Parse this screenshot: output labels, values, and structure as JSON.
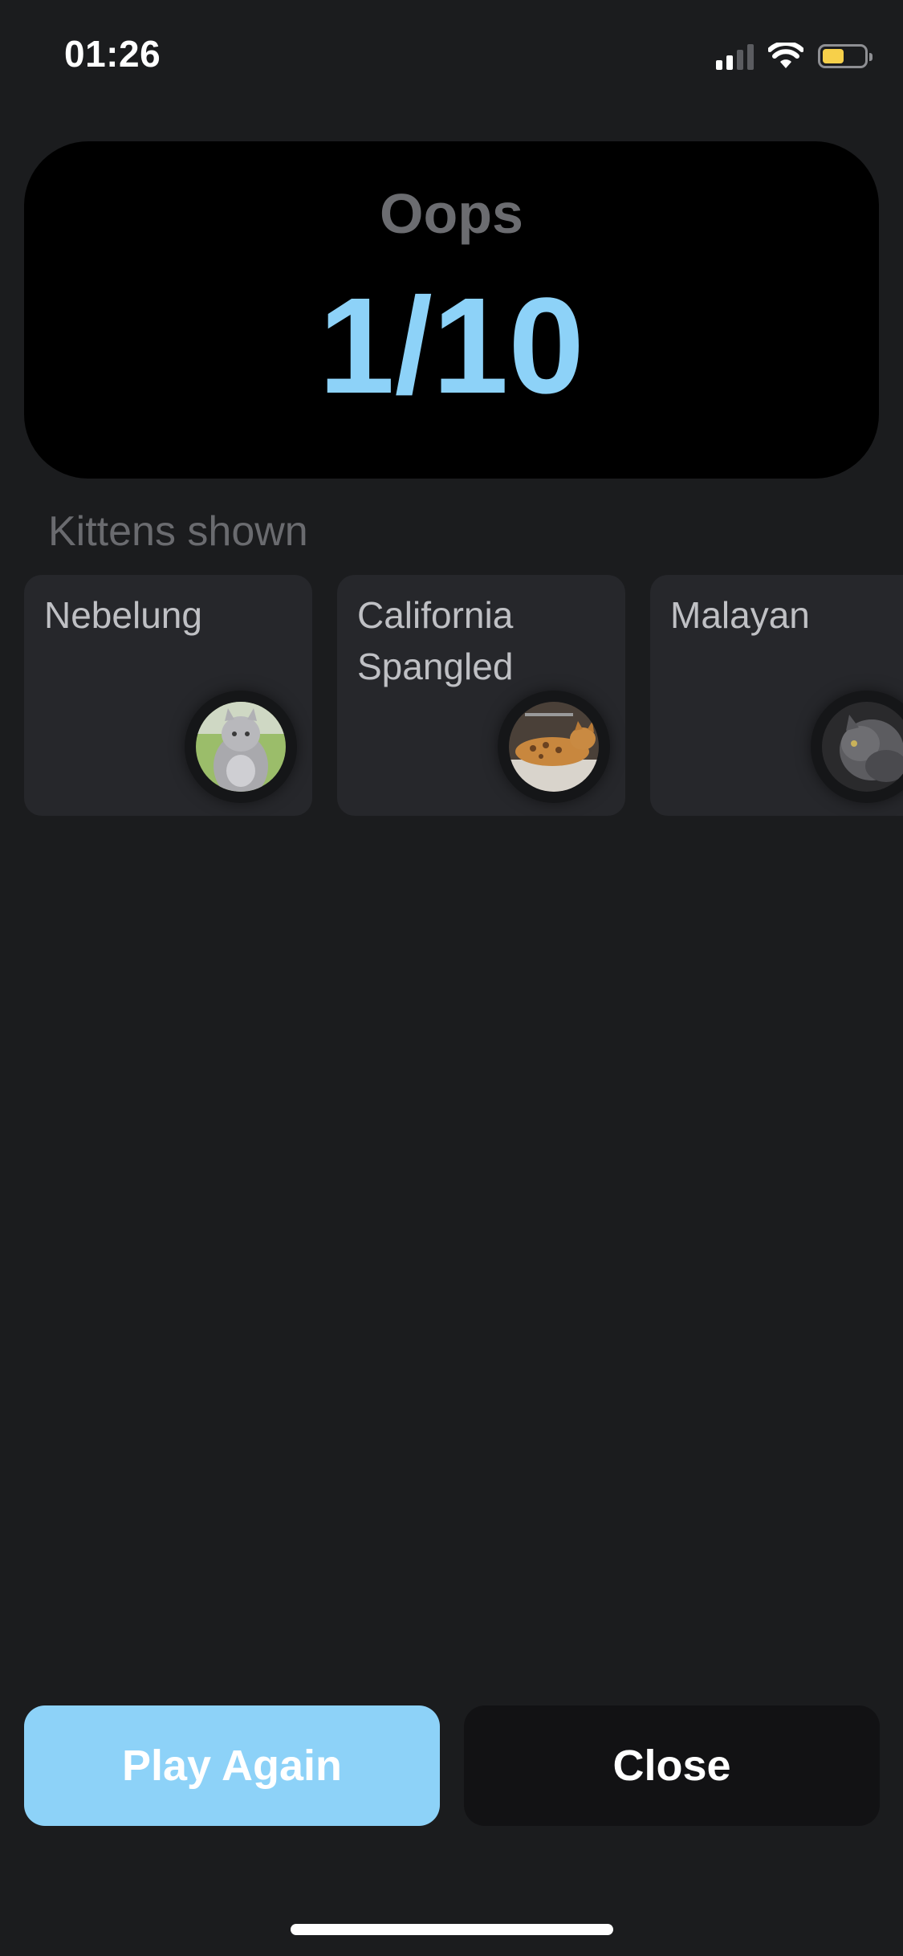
{
  "status_bar": {
    "time": "01:26",
    "icons": [
      "cellular-signal-icon",
      "wifi-icon",
      "battery-icon"
    ],
    "battery_color": "#f7d04a"
  },
  "result": {
    "title": "Oops",
    "score": "1/10"
  },
  "kittens_section": {
    "label": "Kittens shown",
    "items": [
      {
        "name": "Nebelung",
        "photo": "gray-longhair-cat-photo"
      },
      {
        "name": "California Spangled",
        "photo": "spotted-tabby-cat-photo"
      },
      {
        "name": "Malayan",
        "photo": "dark-gray-cat-photo"
      }
    ]
  },
  "actions": {
    "play_again": "Play Again",
    "close": "Close"
  },
  "colors": {
    "background": "#1b1c1e",
    "accent": "#8dd2f8",
    "card": "#26272b"
  }
}
